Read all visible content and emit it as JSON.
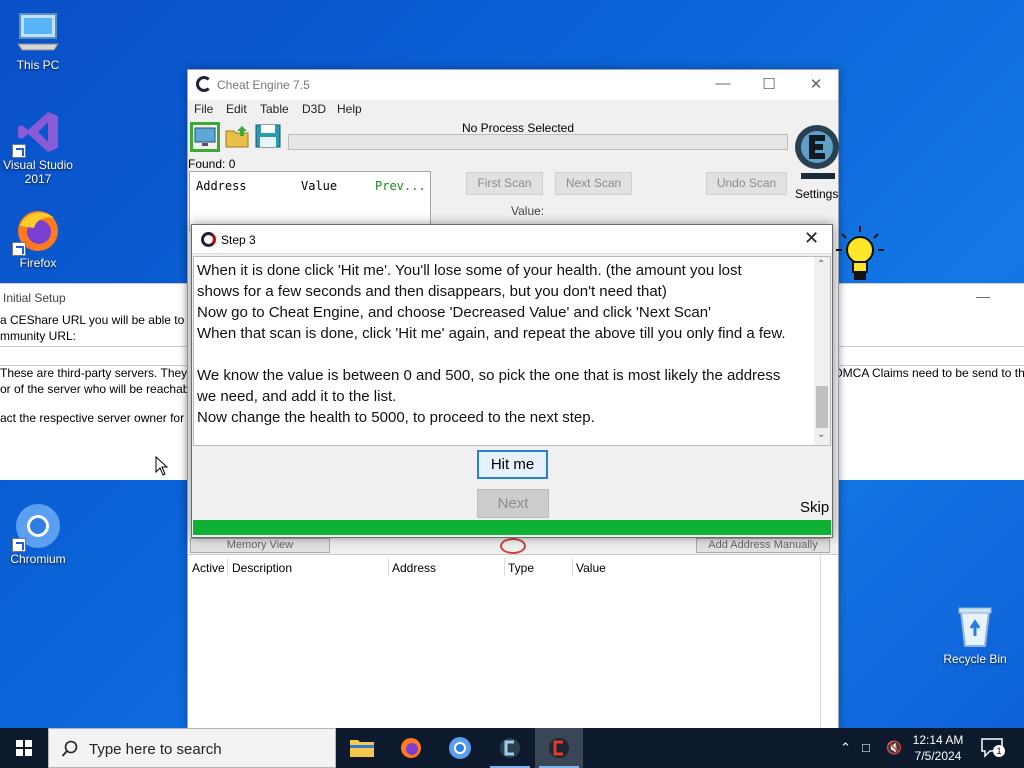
{
  "desktop": {
    "icons": [
      {
        "label": "This PC"
      },
      {
        "label": "Visual Studio 2017"
      },
      {
        "label": "Firefox"
      },
      {
        "label": "Chromium"
      },
      {
        "label": "Recycle Bin"
      }
    ]
  },
  "setup_window": {
    "title": "Initial Setup",
    "line1": "a CEShare URL you will be able to up",
    "line2": "mmunity URL:",
    "line3": "These are third-party servers. They are",
    "line3_right": "DMCA Claims need to be send to th",
    "line4": "or of the server who will be reachable",
    "line5": "act the respective server owner for fu"
  },
  "cheat_engine": {
    "title": "Cheat Engine 7.5",
    "menu": [
      "File",
      "Edit",
      "Table",
      "D3D",
      "Help"
    ],
    "process_label": "No Process Selected",
    "found_label": "Found: 0",
    "address_columns": [
      "Address",
      "Value",
      "Prev..."
    ],
    "first_scan": "First Scan",
    "next_scan": "Next Scan",
    "undo_scan": "Undo Scan",
    "value_label": "Value:",
    "settings_label": "Settings",
    "memory_view": "Memory View",
    "add_address": "Add Address Manually",
    "table_columns": [
      "Active",
      "Description",
      "Address",
      "Type",
      "Value"
    ]
  },
  "step_dialog": {
    "title": "Step 3",
    "lines": [
      "When it is done click 'Hit me'. You'll lose some of your health. (the amount you lost",
      "shows for a few seconds and then disappears, but you don't need that)",
      "Now go to Cheat Engine, and choose 'Decreased Value' and click 'Next Scan'",
      "When that scan is done, click 'Hit me' again, and repeat the above till you only find a few.",
      "",
      "We know the value is between 0 and 500, so pick the one that is most likely the address",
      "we need, and add it to the list.",
      "Now change the health to 5000, to proceed to the next step."
    ],
    "hit_me": "Hit me",
    "next": "Next",
    "skip": "Skip",
    "progress": 1.0
  },
  "taskbar": {
    "search_placeholder": "Type here to search",
    "time": "12:14 AM",
    "date": "7/5/2024",
    "notification_count": "1"
  }
}
